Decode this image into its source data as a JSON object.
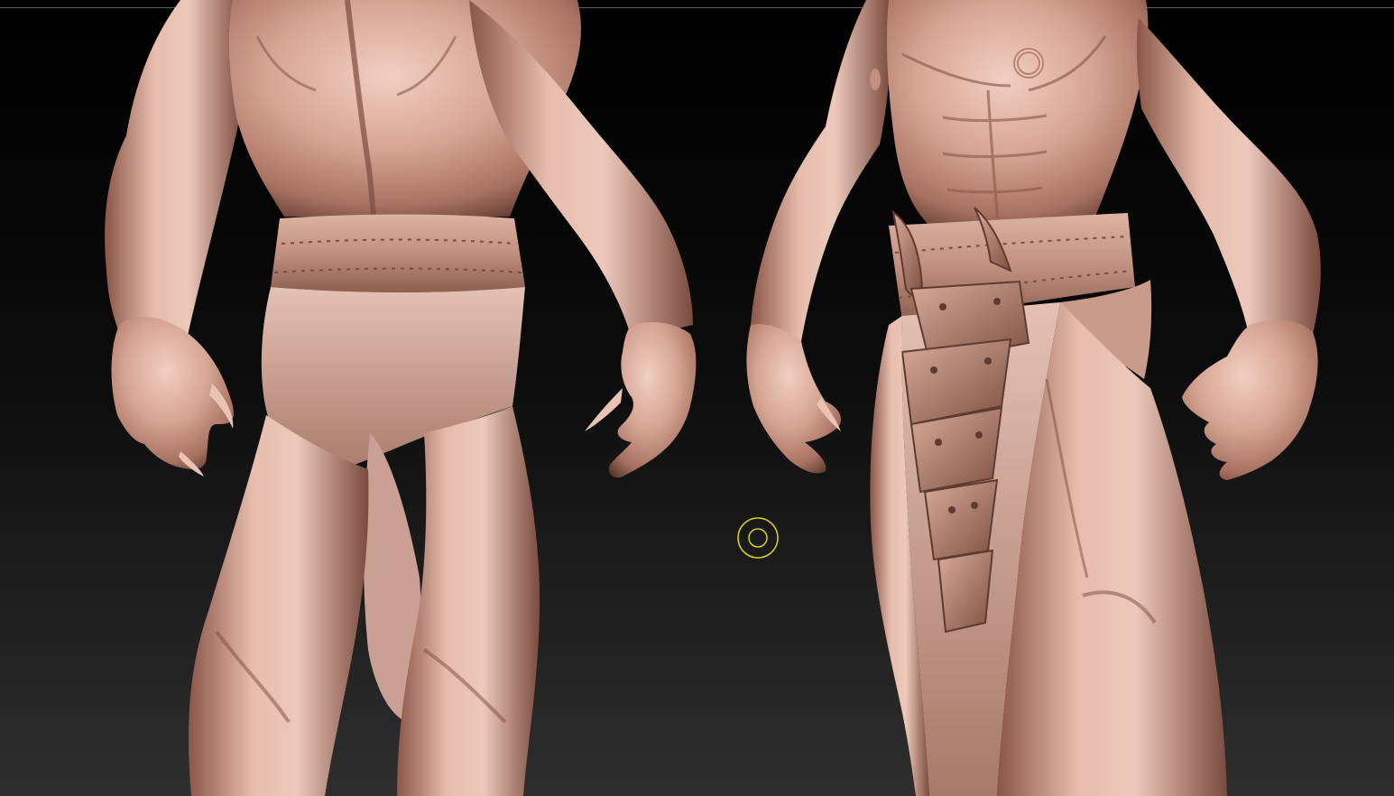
{
  "viewport": {
    "background_top": "#000000",
    "background_bottom": "#2e2e2e",
    "top_line_color": "#5a5a5a"
  },
  "sculpt": {
    "subjects": [
      "back-view-figure",
      "front-view-figure"
    ],
    "skin_light": "#e9c3b4",
    "skin_mid": "#b98472",
    "skin_dark": "#5e3a30",
    "cloth_light": "#d9b3a5",
    "belt_color": "#c79a8a"
  },
  "brush_cursor": {
    "icon": "brush-ring-icon",
    "color": "#d9d21c"
  }
}
